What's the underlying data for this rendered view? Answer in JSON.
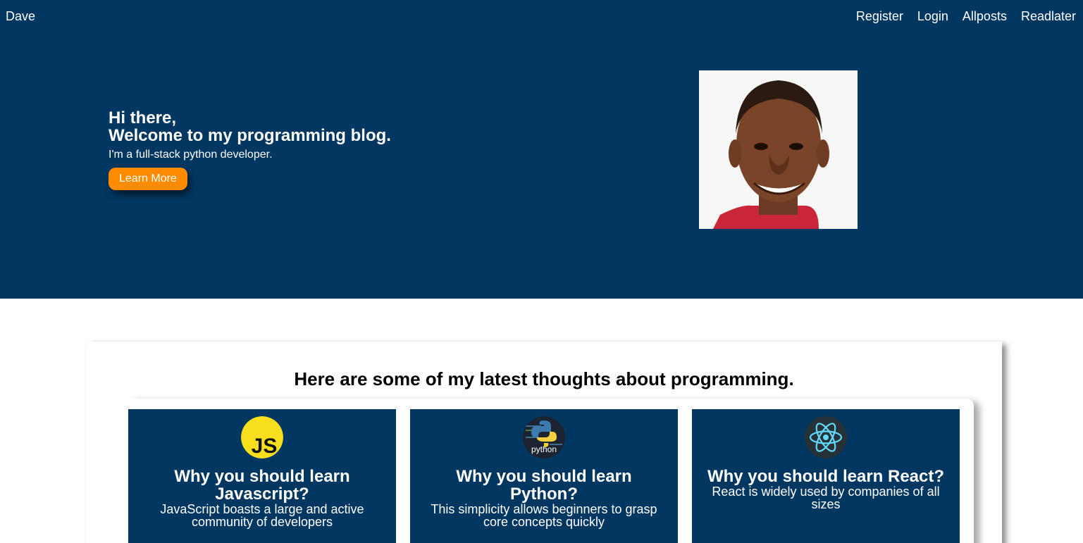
{
  "nav": {
    "brand": "Dave",
    "links": [
      "Register",
      "Login",
      "Allposts",
      "Readlater"
    ]
  },
  "hero": {
    "greeting": "Hi there,",
    "welcome": "Welcome to my programming blog.",
    "tagline": "I'm a full-stack python developer.",
    "button_label": "Learn More"
  },
  "section": {
    "title": "Here are some of my latest thoughts about programming."
  },
  "cards": [
    {
      "icon": "javascript-logo-icon",
      "title": "Why you should learn Javascript?",
      "text": "JavaScript boasts a large and active community of developers"
    },
    {
      "icon": "python-logo-icon",
      "title": "Why you should learn Python?",
      "text": "This simplicity allows beginners to grasp core concepts quickly"
    },
    {
      "icon": "react-logo-icon",
      "title": "Why you should learn React?",
      "text": "React is widely used by companies of all sizes"
    }
  ],
  "colors": {
    "primary": "#023761",
    "accent": "#ff8c00",
    "js_yellow": "#f7df1e",
    "react_blue": "#61dafb"
  }
}
